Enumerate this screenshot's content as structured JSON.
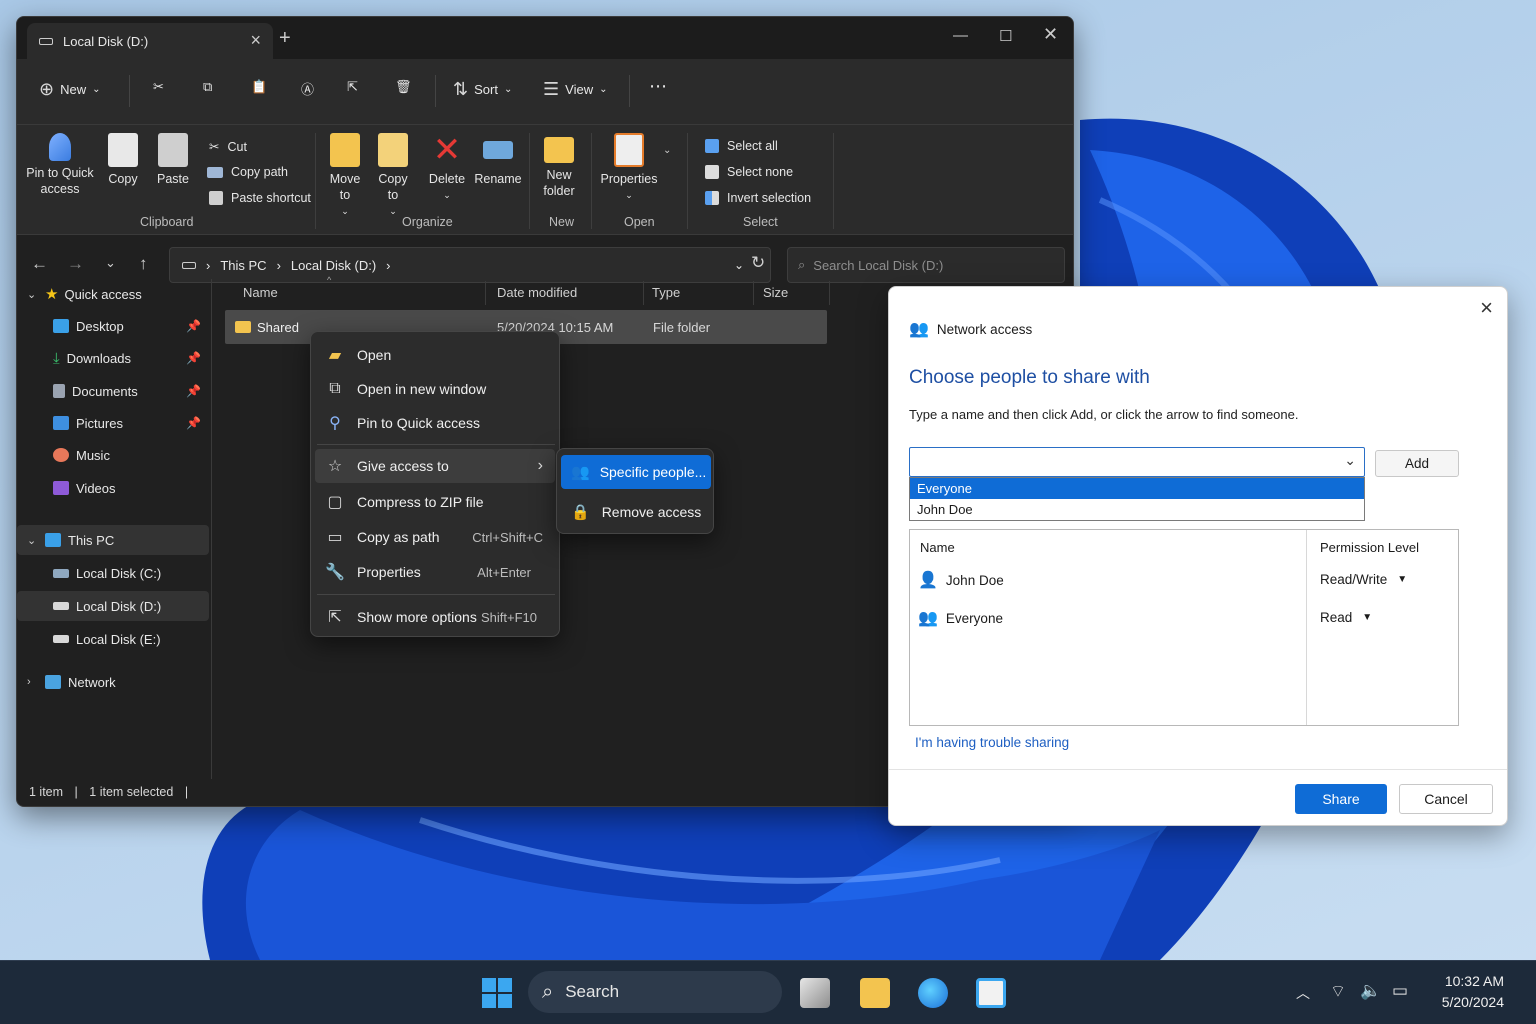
{
  "explorer": {
    "tab_title": "Local Disk (D:)",
    "cmdbar": {
      "new": "New",
      "sort": "Sort",
      "view": "View",
      "more": "⋯"
    },
    "ribbon": {
      "pin": "Pin to Quick access",
      "copy": "Copy",
      "paste": "Paste",
      "cut": "Cut",
      "copy_path": "Copy path",
      "paste_shortcut": "Paste shortcut",
      "clipboard": "Clipboard",
      "move_to": "Move to",
      "copy_to": "Copy to",
      "delete": "Delete",
      "rename": "Rename",
      "organize": "Organize",
      "new_folder": "New folder",
      "new": "New",
      "properties": "Properties",
      "open": "Open",
      "select_all": "Select all",
      "select_none": "Select none",
      "invert_selection": "Invert selection",
      "select": "Select"
    },
    "address": {
      "this_pc": "This PC",
      "drive": "Local Disk (D:)"
    },
    "search_placeholder": "Search Local Disk (D:)",
    "sidebar": {
      "quick_access": "Quick access",
      "desktop": "Desktop",
      "downloads": "Downloads",
      "documents": "Documents",
      "pictures": "Pictures",
      "music": "Music",
      "videos": "Videos",
      "this_pc": "This PC",
      "disk_c": "Local Disk (C:)",
      "disk_d": "Local Disk (D:)",
      "disk_e": "Local Disk (E:)",
      "network": "Network"
    },
    "columns": {
      "name": "Name",
      "date": "Date modified",
      "type": "Type",
      "size": "Size"
    },
    "file": {
      "name": "Shared",
      "date": "5/20/2024 10:15 AM",
      "type": "File folder"
    },
    "status": {
      "count": "1 item",
      "selected": "1 item selected"
    }
  },
  "context_menu": {
    "open": "Open",
    "open_new_window": "Open in new window",
    "pin_quick": "Pin to Quick access",
    "give_access": "Give access to",
    "compress": "Compress to ZIP file",
    "copy_path": "Copy as path",
    "copy_path_sc": "Ctrl+Shift+C",
    "properties": "Properties",
    "properties_sc": "Alt+Enter",
    "more_options": "Show more options",
    "more_options_sc": "Shift+F10"
  },
  "submenu": {
    "specific_people": "Specific people...",
    "remove_access": "Remove access"
  },
  "dialog": {
    "header": "Network access",
    "title": "Choose people to share with",
    "instructions": "Type a name and then click Add, or click the arrow to find someone.",
    "add": "Add",
    "dropdown": [
      "Everyone",
      "John Doe"
    ],
    "table": {
      "name_header": "Name",
      "perm_header": "Permission Level",
      "rows": [
        {
          "name": "John Doe",
          "permission": "Read/Write"
        },
        {
          "name": "Everyone",
          "permission": "Read"
        }
      ]
    },
    "trouble": "I'm having trouble sharing",
    "share": "Share",
    "cancel": "Cancel"
  },
  "taskbar": {
    "search": "Search",
    "time": "10:32 AM",
    "date": "5/20/2024"
  },
  "colors": {
    "accent": "#0f6cd6",
    "explorer_bg": "#202020",
    "dialog_link": "#1e5fc2"
  }
}
